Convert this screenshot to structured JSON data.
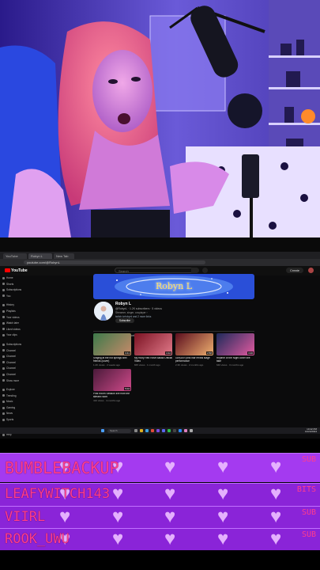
{
  "browser": {
    "tabs": [
      "YouTube",
      "Robyn L",
      "New Tab"
    ],
    "url": "youtube.com/@RobynL"
  },
  "youtube": {
    "logo_text": "YouTube",
    "search_placeholder": "Search",
    "create_label": "Create",
    "sidebar": {
      "items": [
        "Home",
        "Shorts",
        "Subscriptions",
        "You",
        "History",
        "Playlists",
        "Your videos",
        "Watch later",
        "Liked videos",
        "Your clips",
        "Subscriptions",
        "Channel",
        "Channel",
        "Channel",
        "Channel",
        "Channel",
        "Show more",
        "Explore",
        "Trending",
        "Music",
        "Gaming",
        "News",
        "Sports",
        "Settings",
        "Help"
      ]
    },
    "channel": {
      "banner_text": "Robyn L",
      "name": "Robyn L",
      "handle_stats": "@RobynL · 1.2K subscribers · 5 videos",
      "description": "Streamer, singer, cosplayer ›",
      "link": "twitch.tv/robynl and 2 more links",
      "subscribe_label": "Subscribe",
      "tabs": [
        "Home",
        "Videos",
        "Shorts",
        "Live",
        "Playlists"
      ]
    },
    "videos": [
      {
        "title": "Singing at the hot springs with friends (cover)",
        "meta": "1.2K views · 2 weeks ago",
        "duration": "3:41",
        "color1": "#3d7a4a",
        "color2": "#c88a6a"
      },
      {
        "title": "My Ruby Red Rose Ballad Official Video",
        "meta": "845 views · 1 month ago",
        "duration": "4:12",
        "color1": "#7a1222",
        "color2": "#e27a8a"
      },
      {
        "title": "GINGER pink hair reveal stage performance",
        "meta": "2.3K views · 2 months ago",
        "duration": "2:58",
        "color1": "#5a0d1d",
        "color2": "#f0b070"
      },
      {
        "title": "Rhythm of the Night cover live take",
        "meta": "640 views · 3 months ago",
        "duration": "3:20",
        "color1": "#1d2a5a",
        "color2": "#e25aa0"
      },
      {
        "title": "Pink Room Session live from the stream room",
        "meta": "410 views · 4 months ago",
        "duration": "5:02",
        "color1": "#4a1a3a",
        "color2": "#d04a8a"
      }
    ]
  },
  "taskbar": {
    "search_placeholder": "Search",
    "time": "10:42 PM",
    "date": "10/24/2024"
  },
  "alerts": [
    {
      "name": "BUMBLEBACKUP",
      "type": "SUB"
    },
    {
      "name": "LEAFYWITCH143",
      "type": "BITS"
    },
    {
      "name": "VIIRL",
      "type": "SUB"
    },
    {
      "name": "ROOK_UWU",
      "type": "SUB"
    }
  ],
  "colors": {
    "alert_bg": "#9a2be0",
    "alert_text": "#ff3c8e",
    "heart": "#e9b8ff",
    "youtube_red": "#ff0000"
  }
}
